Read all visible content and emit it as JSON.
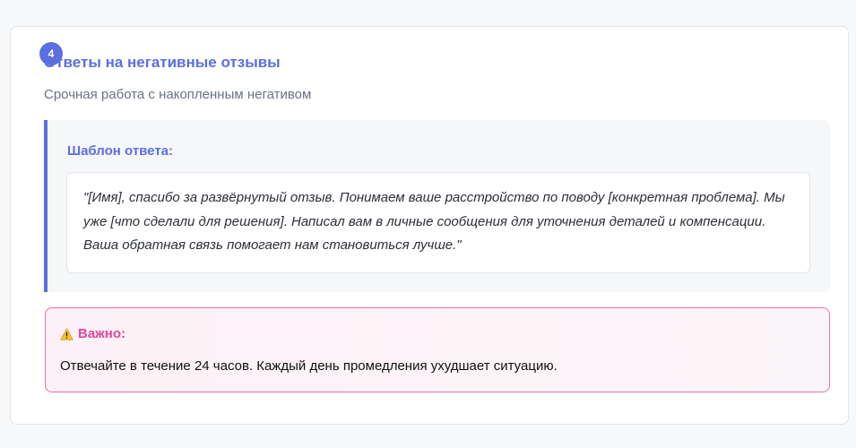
{
  "card": {
    "step_number": "4",
    "title": "Ответы на негативные отзывы",
    "subtitle": "Срочная работа с накопленным негативом"
  },
  "template": {
    "label": "Шаблон ответа:",
    "text": "\"[Имя], спасибо за развёрнутый отзыв. Понимаем ваше расстройство по поводу [конкретная проблема]. Мы уже [что сделали для решения]. Написал вам в личные сообщения для уточнения деталей и компенсации. Ваша обратная связь помогает нам становиться лучше.\""
  },
  "warning": {
    "icon": "warning-icon",
    "title": "Важно:",
    "text": "Отвечайте в течение 24 часов. Каждый день промедления ухудшает ситуацию."
  },
  "colors": {
    "accent": "#5a6fe0",
    "warning_accent": "#e0479a",
    "warning_border": "#ec6fb0"
  }
}
